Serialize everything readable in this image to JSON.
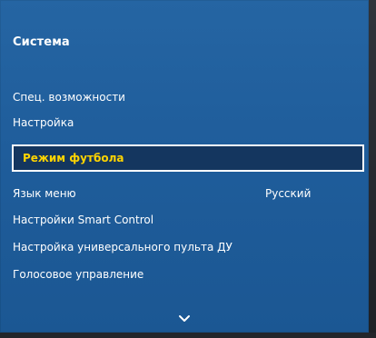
{
  "screen": {
    "title": "Система"
  },
  "menu": {
    "items": [
      {
        "label": "Спец. возможности"
      },
      {
        "label": "Настройка"
      },
      {
        "label": "Режим футбола"
      },
      {
        "label": "Язык меню",
        "value": "Русский"
      },
      {
        "label": "Настройки Smart Control"
      },
      {
        "label": "Настройка универсального пульта ДУ"
      },
      {
        "label": "Голосовое управление"
      }
    ]
  },
  "icons": {
    "scroll_down": "chevron-down-icon"
  },
  "colors": {
    "panel_blue": "#1f5d9b",
    "selection_background": "#14365f",
    "selection_border": "#ffffff",
    "selected_text": "#ffd400",
    "text": "#ffffff"
  }
}
